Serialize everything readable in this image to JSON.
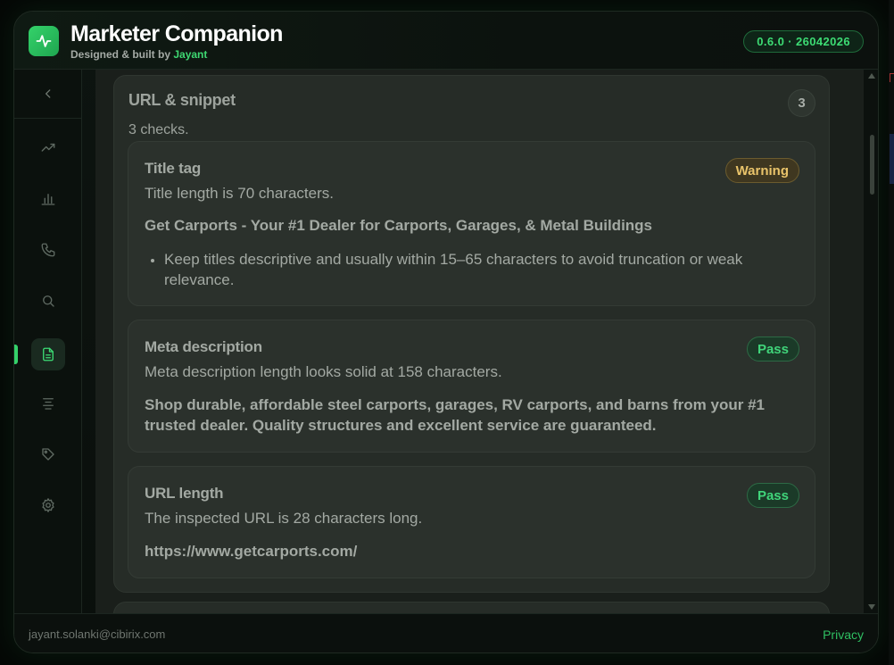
{
  "header": {
    "title": "Marketer Companion",
    "subtitle_prefix": "Designed & built by ",
    "author": "Jayant",
    "version": "0.6.0 · 26042026"
  },
  "sidebar": {
    "items": [
      {
        "name": "trending-icon"
      },
      {
        "name": "bar-chart-icon"
      },
      {
        "name": "phone-icon"
      },
      {
        "name": "search-icon"
      },
      {
        "name": "document-icon",
        "active": true
      },
      {
        "name": "align-center-icon"
      },
      {
        "name": "tag-icon"
      },
      {
        "name": "gear-icon"
      }
    ]
  },
  "section": {
    "title": "URL & snippet",
    "count": "3",
    "description": "3 checks."
  },
  "cards": [
    {
      "title": "Title tag",
      "status": "Warning",
      "text": "Title length is 70 characters.",
      "value": "Get Carports - Your #1 Dealer for Carports, Garages, & Metal Buildings",
      "tip": "Keep titles descriptive and usually within 15–65 characters to avoid truncation or weak relevance."
    },
    {
      "title": "Meta description",
      "status": "Pass",
      "text": "Meta description length looks solid at 158 characters.",
      "value": "Shop durable, affordable steel carports, garages, RV carports, and barns from your #1 trusted dealer. Quality structures and excellent service are guaranteed."
    },
    {
      "title": "URL length",
      "status": "Pass",
      "text": "The inspected URL is 28 characters long.",
      "value": "https://www.getcarports.com/"
    }
  ],
  "footer": {
    "email": "jayant.solanki@cibirix.com",
    "privacy": "Privacy"
  },
  "colors": {
    "accent": "#34d26a",
    "warning": "#e9c36a",
    "pass": "#40d47a"
  }
}
